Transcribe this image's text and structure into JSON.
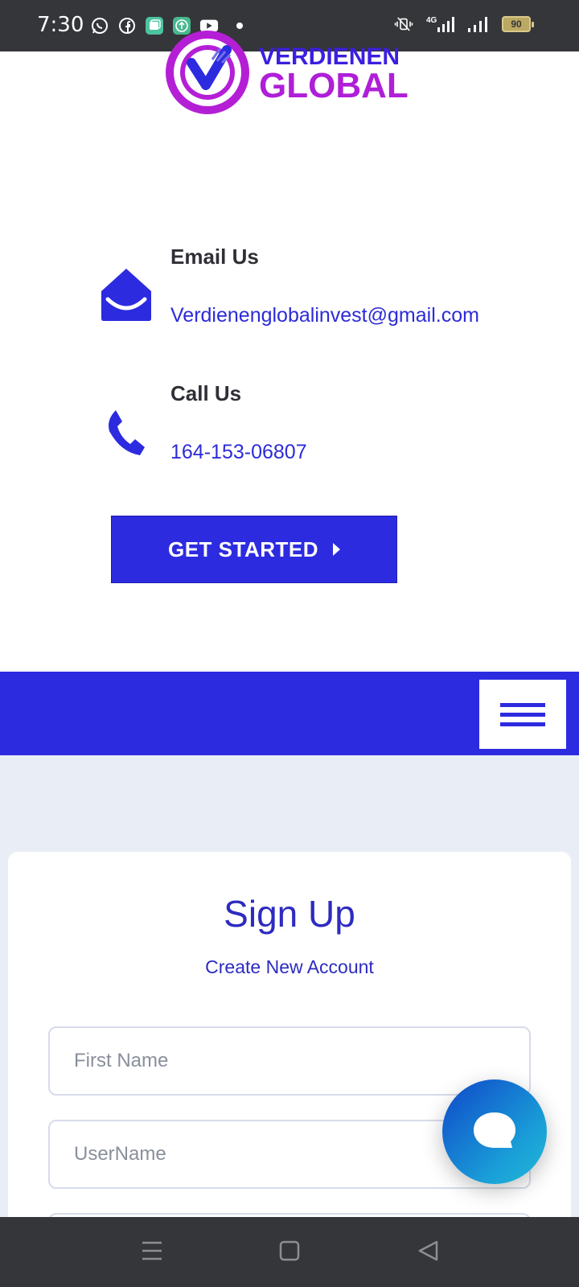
{
  "status_bar": {
    "time": "7:30",
    "battery": "90",
    "network": "4G",
    "left_icons": [
      "whatsapp-icon",
      "facebook-icon",
      "gallery-icon",
      "upload-icon",
      "youtube-icon"
    ],
    "right_icons": [
      "vibrate-mute-icon",
      "signal-4g-icon",
      "signal-icon",
      "battery-icon"
    ]
  },
  "logo": {
    "line1": "VERDIENEN",
    "line2": "GLOBAL",
    "ring_text": "VERDIENEN GLOBAL"
  },
  "contact": {
    "email_title": "Email Us",
    "email_value": "Verdienenglobalinvest@gmail.com",
    "call_title": "Call Us",
    "call_value": "164-153-06807"
  },
  "cta": {
    "get_started_label": "GET STARTED"
  },
  "signup": {
    "title": "Sign Up",
    "subtitle": "Create New Account",
    "first_name_placeholder": "First Name",
    "username_placeholder": "UserName"
  },
  "colors": {
    "primary": "#2d2be0",
    "logo_purple": "#b01ed8",
    "section_bg": "#e9edf5",
    "status_bar": "#35363a"
  }
}
